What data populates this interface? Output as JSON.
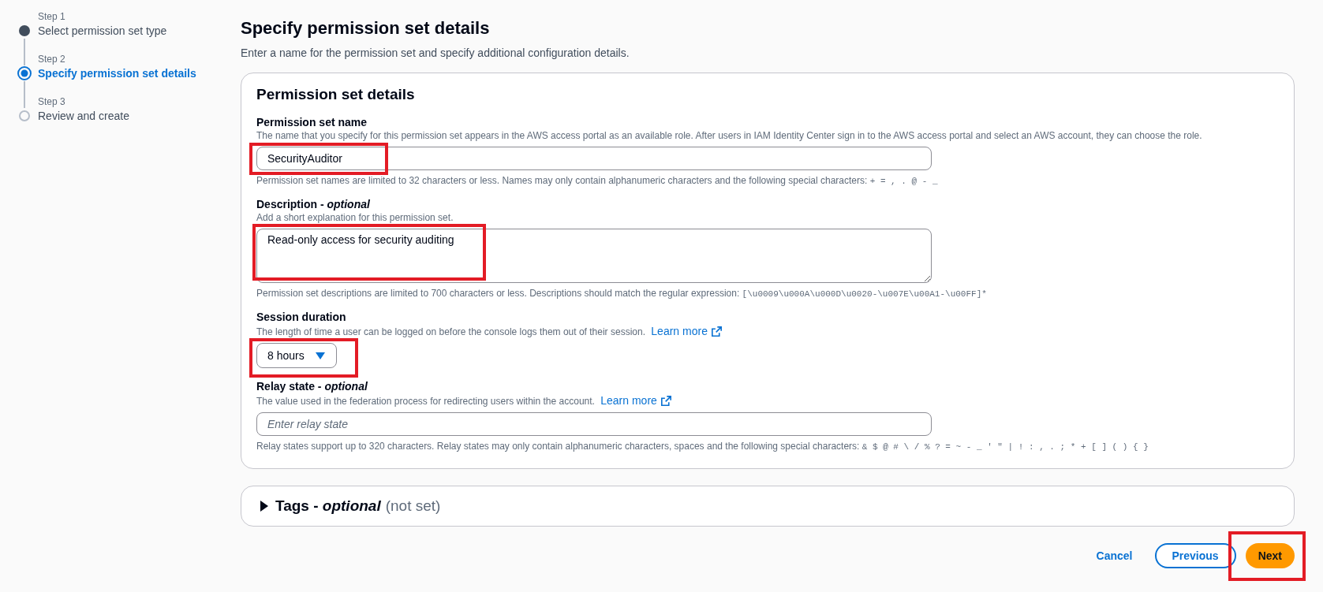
{
  "steps": [
    {
      "step": "Step 1",
      "label": "Select permission set type",
      "completed": true,
      "selected": false
    },
    {
      "step": "Step 2",
      "label": "Specify permission set details",
      "completed": false,
      "selected": true
    },
    {
      "step": "Step 3",
      "label": "Review and create",
      "completed": false,
      "selected": false
    }
  ],
  "header": {
    "title": "Specify permission set details",
    "description": "Enter a name for the permission set and specify additional configuration details."
  },
  "details_panel": {
    "title": "Permission set details",
    "fields": [
      {
        "kind": "text",
        "label": "Permission set name",
        "hint": "The name that you specify for this permission set appears in the AWS access portal as an available role. After users in IAM Identity Center sign in to the AWS access portal and select an AWS account, they can choose the role.",
        "value": "SecurityAuditor",
        "constraint": "Permission set names are limited to 32 characters or less. Names may only contain alphanumeric characters and the following special characters:",
        "constraint_code": "+ = , . @ - _",
        "highlighted": true
      },
      {
        "kind": "textarea",
        "label": "Description - *optional*",
        "hint": "Add a short explanation for this permission set.",
        "value": "Read-only access for security auditing",
        "constraint": "Permission set descriptions are limited to 700 characters or less. Descriptions should match the regular expression:",
        "constraint_code": "[\\u0009\\u000A\\u000D\\u0020-\\u007E\\u00A1-\\u00FF]*",
        "highlighted": true
      },
      {
        "kind": "select",
        "label": "Session duration",
        "hint": "The length of time a user can be logged on before the console logs them out of their session.",
        "link": "Learn more",
        "value": "8 hours",
        "highlighted": true
      },
      {
        "kind": "text",
        "label": "Relay state - *optional*",
        "hint": "The value used in the federation process for redirecting users within the account.",
        "link": "Learn more",
        "placeholder": "Enter relay state",
        "constraint": "Relay states support up to 320 characters. Relay states may only contain alphanumeric characters, spaces and the following special characters:",
        "constraint_code": "& $ @ # \\ / % ? = ~ - _ ' \" | ! : , . ; * + [ ] ( ) { }",
        "highlighted": false
      }
    ]
  },
  "tags_panel": {
    "title": "Tags - *optional*",
    "status": "(not set)",
    "expanded": false
  },
  "actions": [
    {
      "kind": "link",
      "label": "Cancel",
      "highlighted": false
    },
    {
      "kind": "secondary",
      "label": "Previous",
      "highlighted": false
    },
    {
      "kind": "primary",
      "label": "Next",
      "highlighted": true
    }
  ]
}
